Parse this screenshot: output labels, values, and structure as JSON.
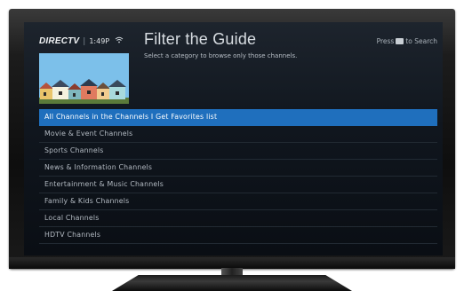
{
  "header": {
    "logo": "DIRECTV",
    "separator": "|",
    "time": "1:49P",
    "wifi_icon": "wifi-icon",
    "title": "Filter the Guide",
    "subtitle": "Select a category to browse only those channels.",
    "search_hint_prefix": "Press",
    "search_hint_suffix": "to Search"
  },
  "channel_filters": [
    {
      "label": "All Channels in the Channels I Get Favorites list",
      "selected": true
    },
    {
      "label": "Movie & Event Channels",
      "selected": false
    },
    {
      "label": "Sports Channels",
      "selected": false
    },
    {
      "label": "News & Information Channels",
      "selected": false
    },
    {
      "label": "Entertainment & Music Channels",
      "selected": false
    },
    {
      "label": "Family & Kids Channels",
      "selected": false
    },
    {
      "label": "Local Channels",
      "selected": false
    },
    {
      "label": "HDTV Channels",
      "selected": false
    }
  ],
  "colors": {
    "selection": "#1f6fbd",
    "background": "#10161e"
  }
}
